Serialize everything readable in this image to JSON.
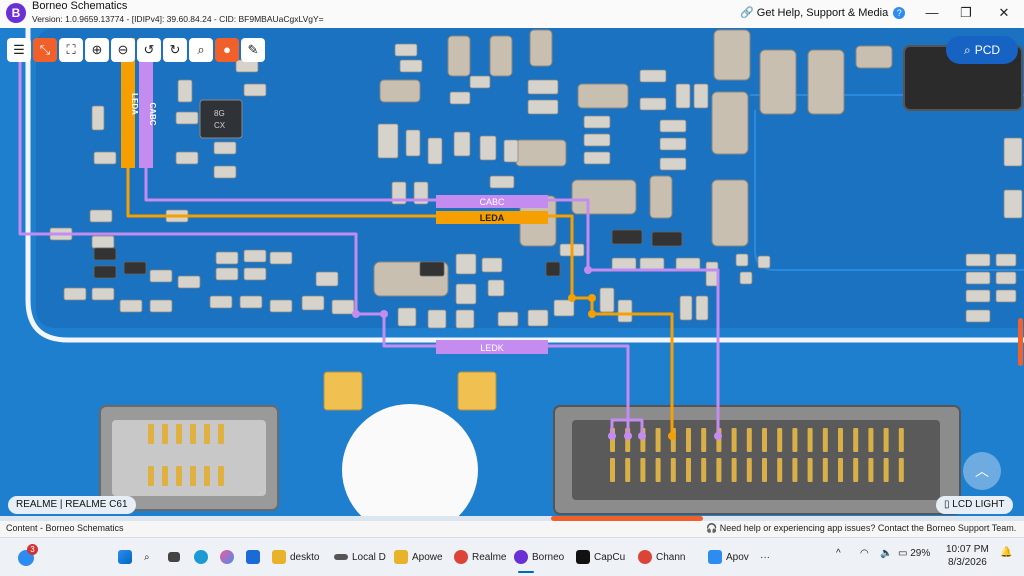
{
  "window": {
    "app_title": "Borneo Schematics",
    "version_line": "Version: 1.0.9659.13774 - [IDIPv4]: 39.60.84.24 - CID: BF9MBAUaCgxLVgY=",
    "help_link": "Get Help, Support & Media",
    "minimize": "—",
    "maximize": "❐",
    "close": "✕"
  },
  "toolbar": {
    "items": [
      {
        "name": "list-icon",
        "glyph": "☰"
      },
      {
        "name": "collapse-icon",
        "glyph": "⤡"
      },
      {
        "name": "fit-screen-icon",
        "glyph": "⛶"
      },
      {
        "name": "zoom-in-icon",
        "glyph": "⊕"
      },
      {
        "name": "zoom-out-icon",
        "glyph": "⊖"
      },
      {
        "name": "rotate-left-icon",
        "glyph": "↺"
      },
      {
        "name": "rotate-right-icon",
        "glyph": "↻"
      },
      {
        "name": "search-icon",
        "glyph": "⌕"
      },
      {
        "name": "mouse-icon",
        "glyph": "●"
      },
      {
        "name": "pen-icon",
        "glyph": "✎"
      }
    ]
  },
  "pcd_button": {
    "label": "PCD",
    "icon": "search-icon"
  },
  "nets": {
    "cabc": "CABC",
    "leda": "LEDA",
    "ledk": "LEDK",
    "cabc_color": "#c58cf0",
    "leda_color": "#f5a000",
    "ledk_color": "#c58cf0"
  },
  "chip_marking": "8G\nCX",
  "board_badge": "REALME | REALME C61",
  "part_badge": "LCD LIGHT",
  "statusbar": {
    "left": "Content - Borneo Schematics",
    "right": "Need help or experiencing app issues? Contact the Borneo Support Team."
  },
  "taskbar": {
    "notification_count": "3",
    "apps": [
      {
        "label": "deskto",
        "icon": "folder-icon",
        "color": "#e8b32a"
      },
      {
        "label": "Local D",
        "icon": "drive-icon",
        "color": "#555555"
      },
      {
        "label": "Apowe",
        "icon": "folder-icon",
        "color": "#e8b32a"
      },
      {
        "label": "Realme",
        "icon": "chrome-icon",
        "color": "#db4437"
      },
      {
        "label": "Borneo",
        "icon": "borneo-icon",
        "color": "#6b2fd6"
      },
      {
        "label": "CapCu",
        "icon": "capcut-icon",
        "color": "#111111"
      },
      {
        "label": "Chann",
        "icon": "chrome-icon",
        "color": "#db4437"
      },
      {
        "label": "Apov",
        "icon": "apowersoft-icon",
        "color": "#2d8cf0"
      }
    ],
    "battery": "29%",
    "time": "10:07 PM",
    "date": "8/3/2026"
  }
}
